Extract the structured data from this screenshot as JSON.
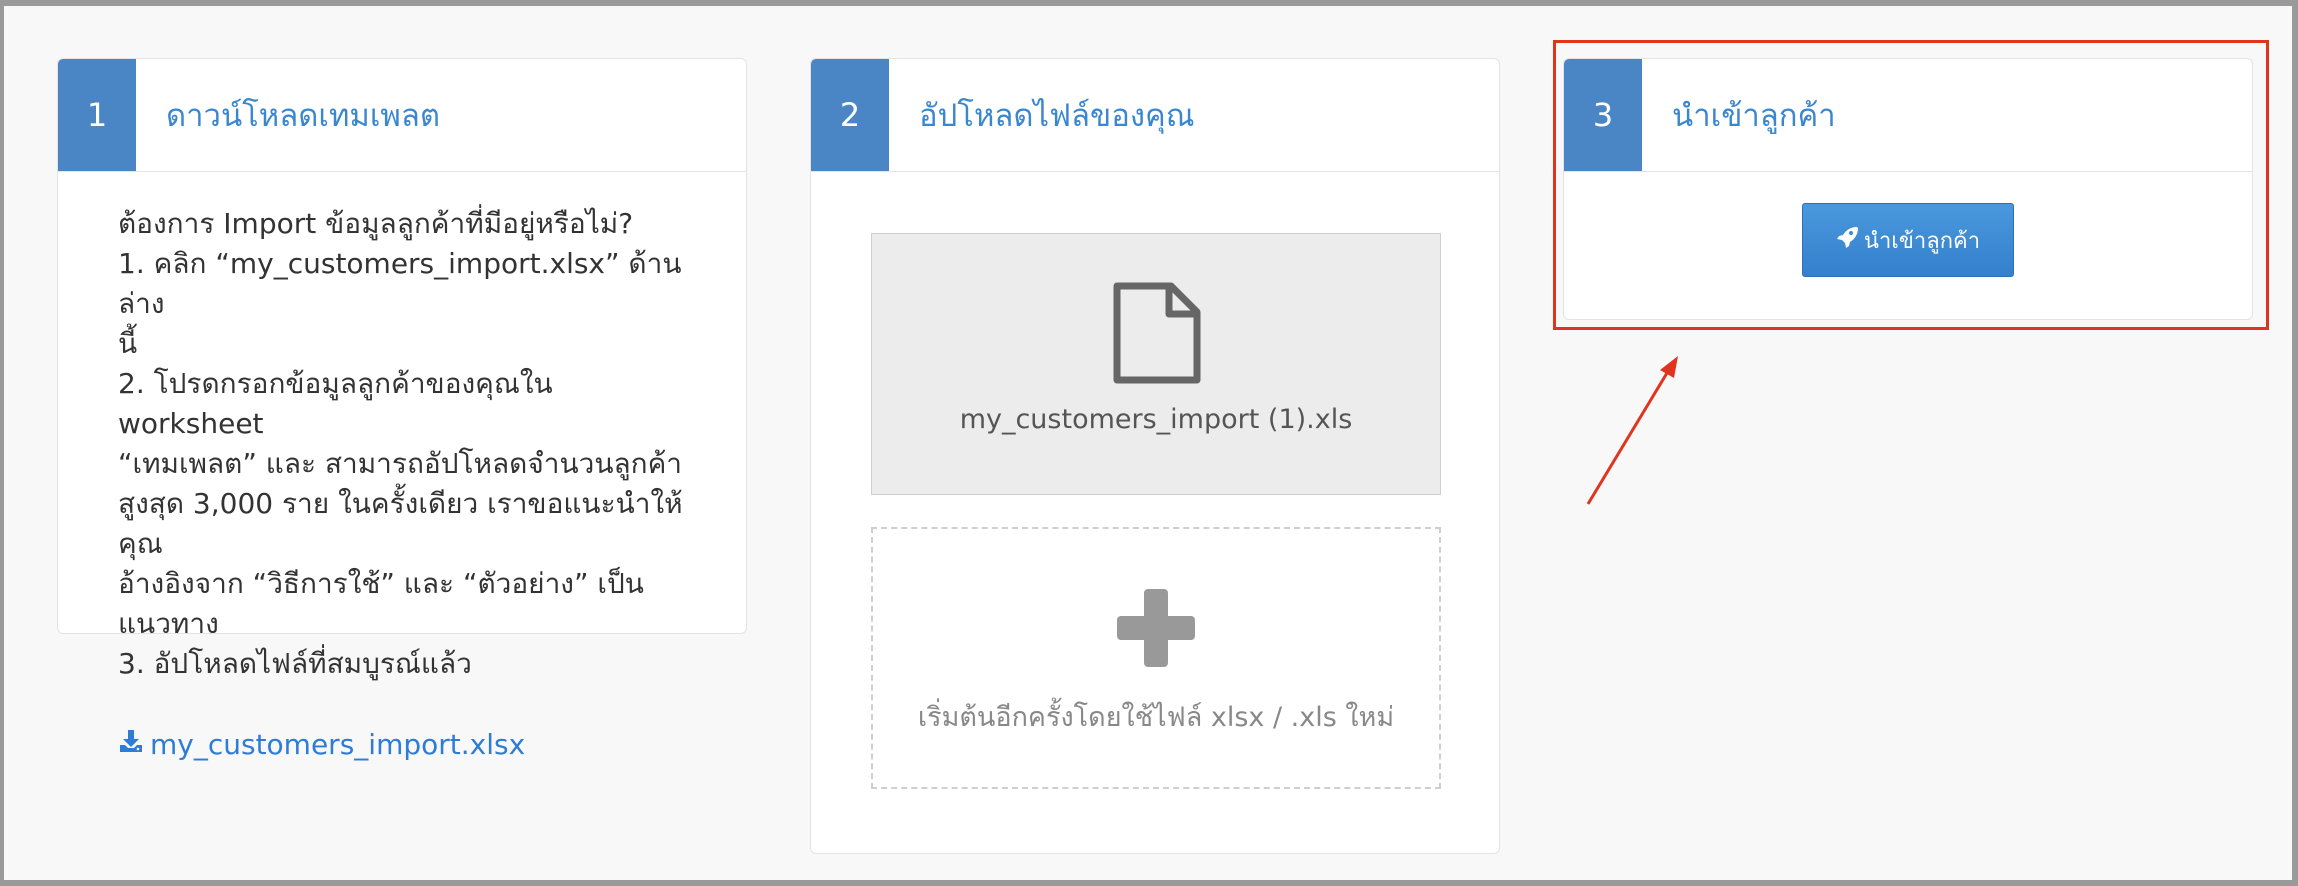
{
  "steps": [
    {
      "number": "1",
      "title": "ดาวน์โหลดเทมเพลต",
      "lines": [
        "ต้องการ Import ข้อมูลลูกค้าที่มีอยู่หรือไม่?",
        "1. คลิก “my_customers_import.xlsx” ด้านล่าง",
        "นี้",
        "2. โปรดกรอกข้อมูลลูกค้าของคุณใน worksheet",
        "“เทมเพลต” และ สามารถอัปโหลดจำนวนลูกค้า",
        "สูงสุด 3,000 ราย ในครั้งเดียว เราขอแนะนำให้คุณ",
        "อ้างอิงจาก “วิธีการใช้” และ “ตัวอย่าง” เป็นแนวทาง",
        "3. อัปโหลดไฟล์ที่สมบูรณ์แล้ว"
      ],
      "download_link": "my_customers_import.xlsx"
    },
    {
      "number": "2",
      "title": "อัปโหลดไฟล์ของคุณ",
      "uploaded_file": "my_customers_import (1).xls",
      "restart_text": "เริ่มต้นอีกครั้งโดยใช้ไฟล์ xlsx / .xls ใหม่"
    },
    {
      "number": "3",
      "title": "นำเข้าลูกค้า",
      "button_label": "นำเข้าลูกค้า"
    }
  ],
  "icons": {
    "download": "download-icon",
    "file": "file-icon",
    "plus": "plus-icon",
    "rocket": "rocket-icon"
  },
  "colors": {
    "accent": "#4a86c5",
    "title": "#3a87cf",
    "button": "#3a8ad3",
    "highlight": "#e0341f"
  }
}
